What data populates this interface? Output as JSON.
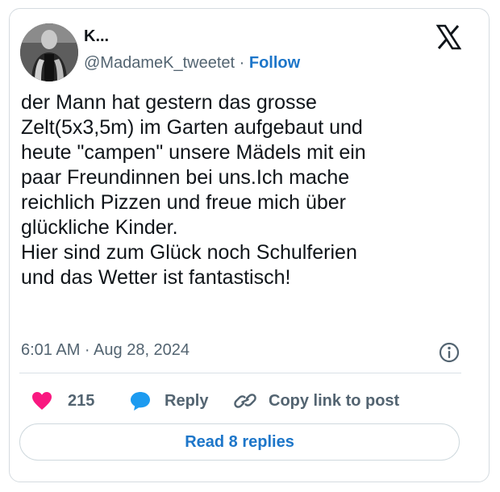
{
  "author": {
    "name": "K...",
    "handle": "@MadameK_tweetet",
    "separator": "·",
    "follow_label": "Follow"
  },
  "tweet": {
    "text": "der Mann hat gestern das grosse\nZelt(5x3,5m) im Garten aufgebaut und\nheute \"campen\" unsere Mädels mit ein\npaar  Freundinnen bei uns.Ich mache\nreichlich Pizzen und freue mich über\nglückliche Kinder.\nHier sind zum Glück noch Schulferien\nund das Wetter ist fantastisch!",
    "timestamp": "6:01 AM · Aug 28, 2024"
  },
  "actions": {
    "like_count": "215",
    "reply_label": "Reply",
    "copy_label": "Copy link to post"
  },
  "read_replies_label": "Read 8 replies",
  "icons": {
    "logo": "x-logo-icon",
    "info": "info-icon",
    "like": "heart-icon",
    "reply": "speech-bubble-icon",
    "copy": "link-icon"
  },
  "colors": {
    "accent": "#1d76c9",
    "like": "#f91880",
    "reply": "#1d9bf0",
    "muted": "#536471",
    "text": "#0f1419",
    "border": "#d5dbe0"
  }
}
